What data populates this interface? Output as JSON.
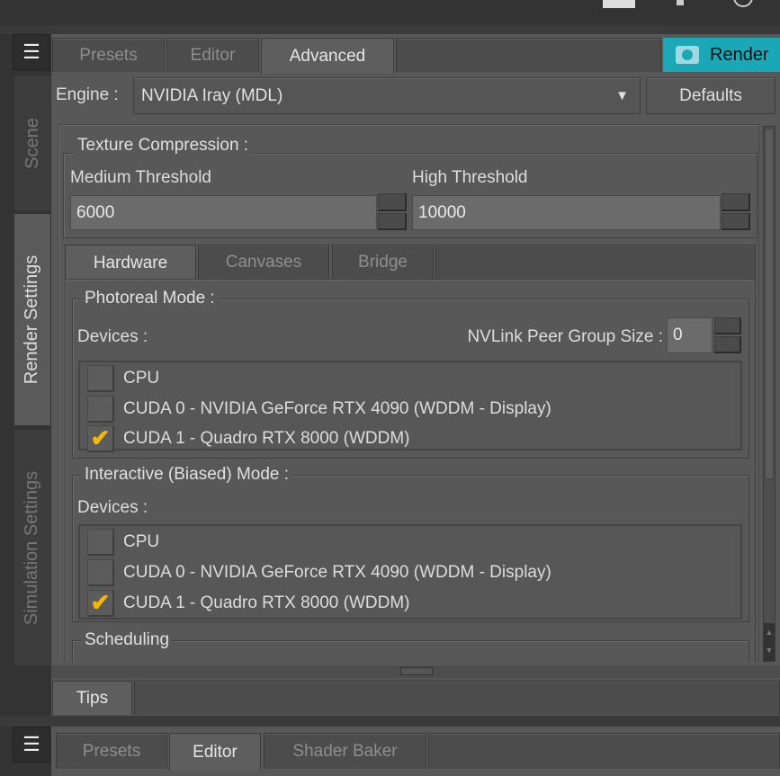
{
  "colors": {
    "accent": "#1aa8b8",
    "check": "#f5b800"
  },
  "side_tabs": [
    "Scene",
    "Render Settings",
    "Simulation Settings"
  ],
  "top_tabs": [
    "Presets",
    "Editor",
    "Advanced"
  ],
  "render_label": "Render",
  "engine": {
    "label": "Engine :",
    "value": "NVIDIA Iray (MDL)",
    "defaults": "Defaults"
  },
  "texture": {
    "title": "Texture Compression :",
    "medium_label": "Medium Threshold",
    "medium_value": "6000",
    "high_label": "High Threshold",
    "high_value": "10000"
  },
  "sub_tabs": [
    "Hardware",
    "Canvases",
    "Bridge"
  ],
  "photoreal": {
    "title": "Photoreal Mode :",
    "devices_label": "Devices :",
    "nvlink_label": "NVLink Peer Group Size :",
    "nvlink_value": "0",
    "devices": [
      {
        "name": "CPU",
        "checked": false
      },
      {
        "name": "CUDA 0 - NVIDIA GeForce RTX 4090 (WDDM - Display)",
        "checked": false
      },
      {
        "name": "CUDA 1 - Quadro RTX 8000 (WDDM)",
        "checked": true
      }
    ]
  },
  "interactive": {
    "title": "Interactive (Biased) Mode :",
    "devices_label": "Devices :",
    "devices": [
      {
        "name": "CPU",
        "checked": false
      },
      {
        "name": "CUDA 0 - NVIDIA GeForce RTX 4090 (WDDM - Display)",
        "checked": false
      },
      {
        "name": "CUDA 1 - Quadro RTX 8000 (WDDM)",
        "checked": true
      }
    ]
  },
  "scheduling": {
    "title": "Scheduling"
  },
  "tips_tab": "Tips",
  "bottom_tabs": [
    "Presets",
    "Editor",
    "Shader Baker"
  ]
}
